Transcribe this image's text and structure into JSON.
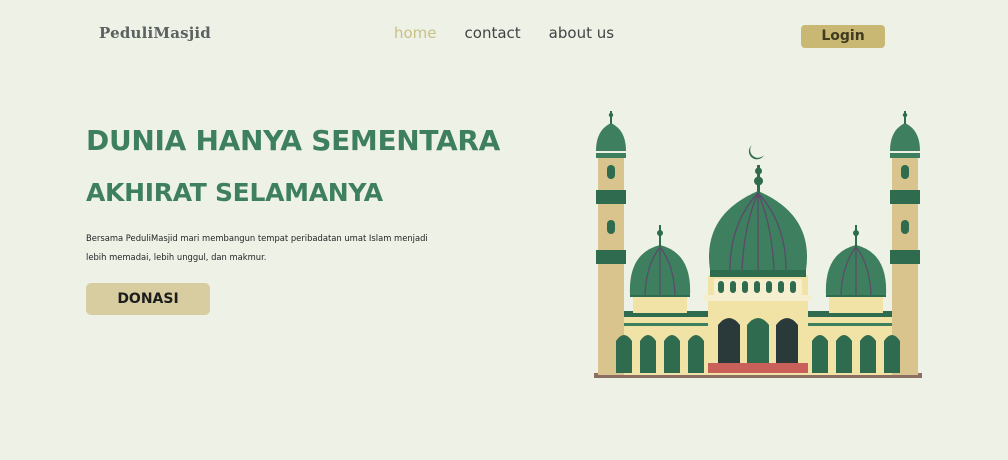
{
  "header": {
    "brand": "PeduliMasjid",
    "nav": [
      {
        "label": "home",
        "active": true
      },
      {
        "label": "contact",
        "active": false
      },
      {
        "label": "about us",
        "active": false
      }
    ],
    "login_label": "Login"
  },
  "hero": {
    "title_line1": "DUNIA HANYA SEMENTARA",
    "title_line2": "AKHIRAT SELAMANYA",
    "description_line1": "Bersama PeduliMasjid mari membangun tempat peribadatan umat Islam menjadi",
    "description_line2": "lebih memadai, lebih unggul, dan makmur.",
    "cta_label": "DONASI"
  },
  "illustration": {
    "icon": "mosque-illustration",
    "colors": {
      "dome": "#3d7f5e",
      "tower": "#d9c48d",
      "wall": "#f1e3a6",
      "trim": "#2f6b4e",
      "accent": "#c9615a"
    }
  },
  "theme": {
    "background": "#eef1e6",
    "primary_green": "#3d7f5e",
    "login_bg": "#c8b873",
    "donate_bg": "#d8cda0",
    "nav_active": "#c8c186"
  }
}
